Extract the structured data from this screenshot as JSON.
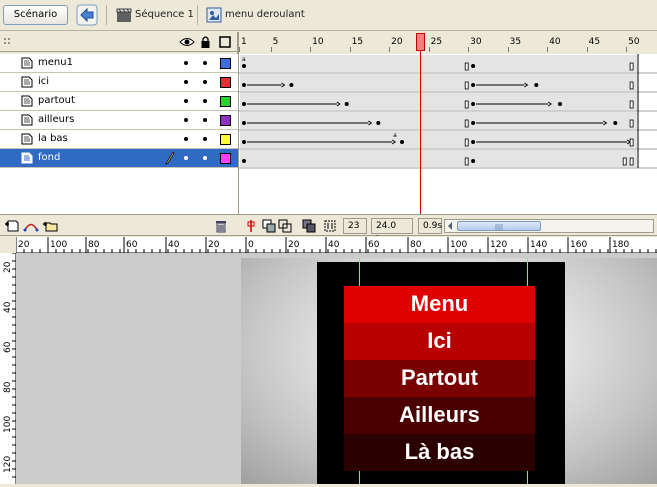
{
  "editbar": {
    "scene_button": "Scénario",
    "crumbs": [
      "Séquence 1",
      "menu deroulant"
    ]
  },
  "timeline": {
    "frame_numbers": [
      "1",
      "5",
      "10",
      "15",
      "20",
      "25",
      "30",
      "35",
      "40",
      "45",
      "50"
    ],
    "current_frame": "23",
    "frame_rate": "24.0 ips",
    "elapsed": "0.9s",
    "layers": [
      {
        "name": "menu1",
        "color": "#3b6fe0",
        "selected": false
      },
      {
        "name": "ici",
        "color": "#e03030",
        "selected": false
      },
      {
        "name": "partout",
        "color": "#30d030",
        "selected": false
      },
      {
        "name": "ailleurs",
        "color": "#9030c0",
        "selected": false
      },
      {
        "name": "la bas",
        "color": "#ffff30",
        "selected": false
      },
      {
        "name": "fond",
        "color": "#ff40ff",
        "selected": true
      }
    ]
  },
  "rulers": {
    "h_labels": [
      "20",
      "100",
      "80",
      "60",
      "40",
      "20",
      "0",
      "20",
      "40",
      "60",
      "80",
      "100",
      "120",
      "140",
      "160",
      "180"
    ],
    "v_labels": [
      "20",
      "40",
      "60",
      "80",
      "100",
      "120"
    ]
  },
  "stage": {
    "menu_items": [
      {
        "label": "Menu",
        "color": "#e00000"
      },
      {
        "label": "Ici",
        "color": "#b80000"
      },
      {
        "label": "Partout",
        "color": "#7a0000"
      },
      {
        "label": "Ailleurs",
        "color": "#4a0000"
      },
      {
        "label": "Là bas",
        "color": "#2a0000"
      }
    ]
  }
}
